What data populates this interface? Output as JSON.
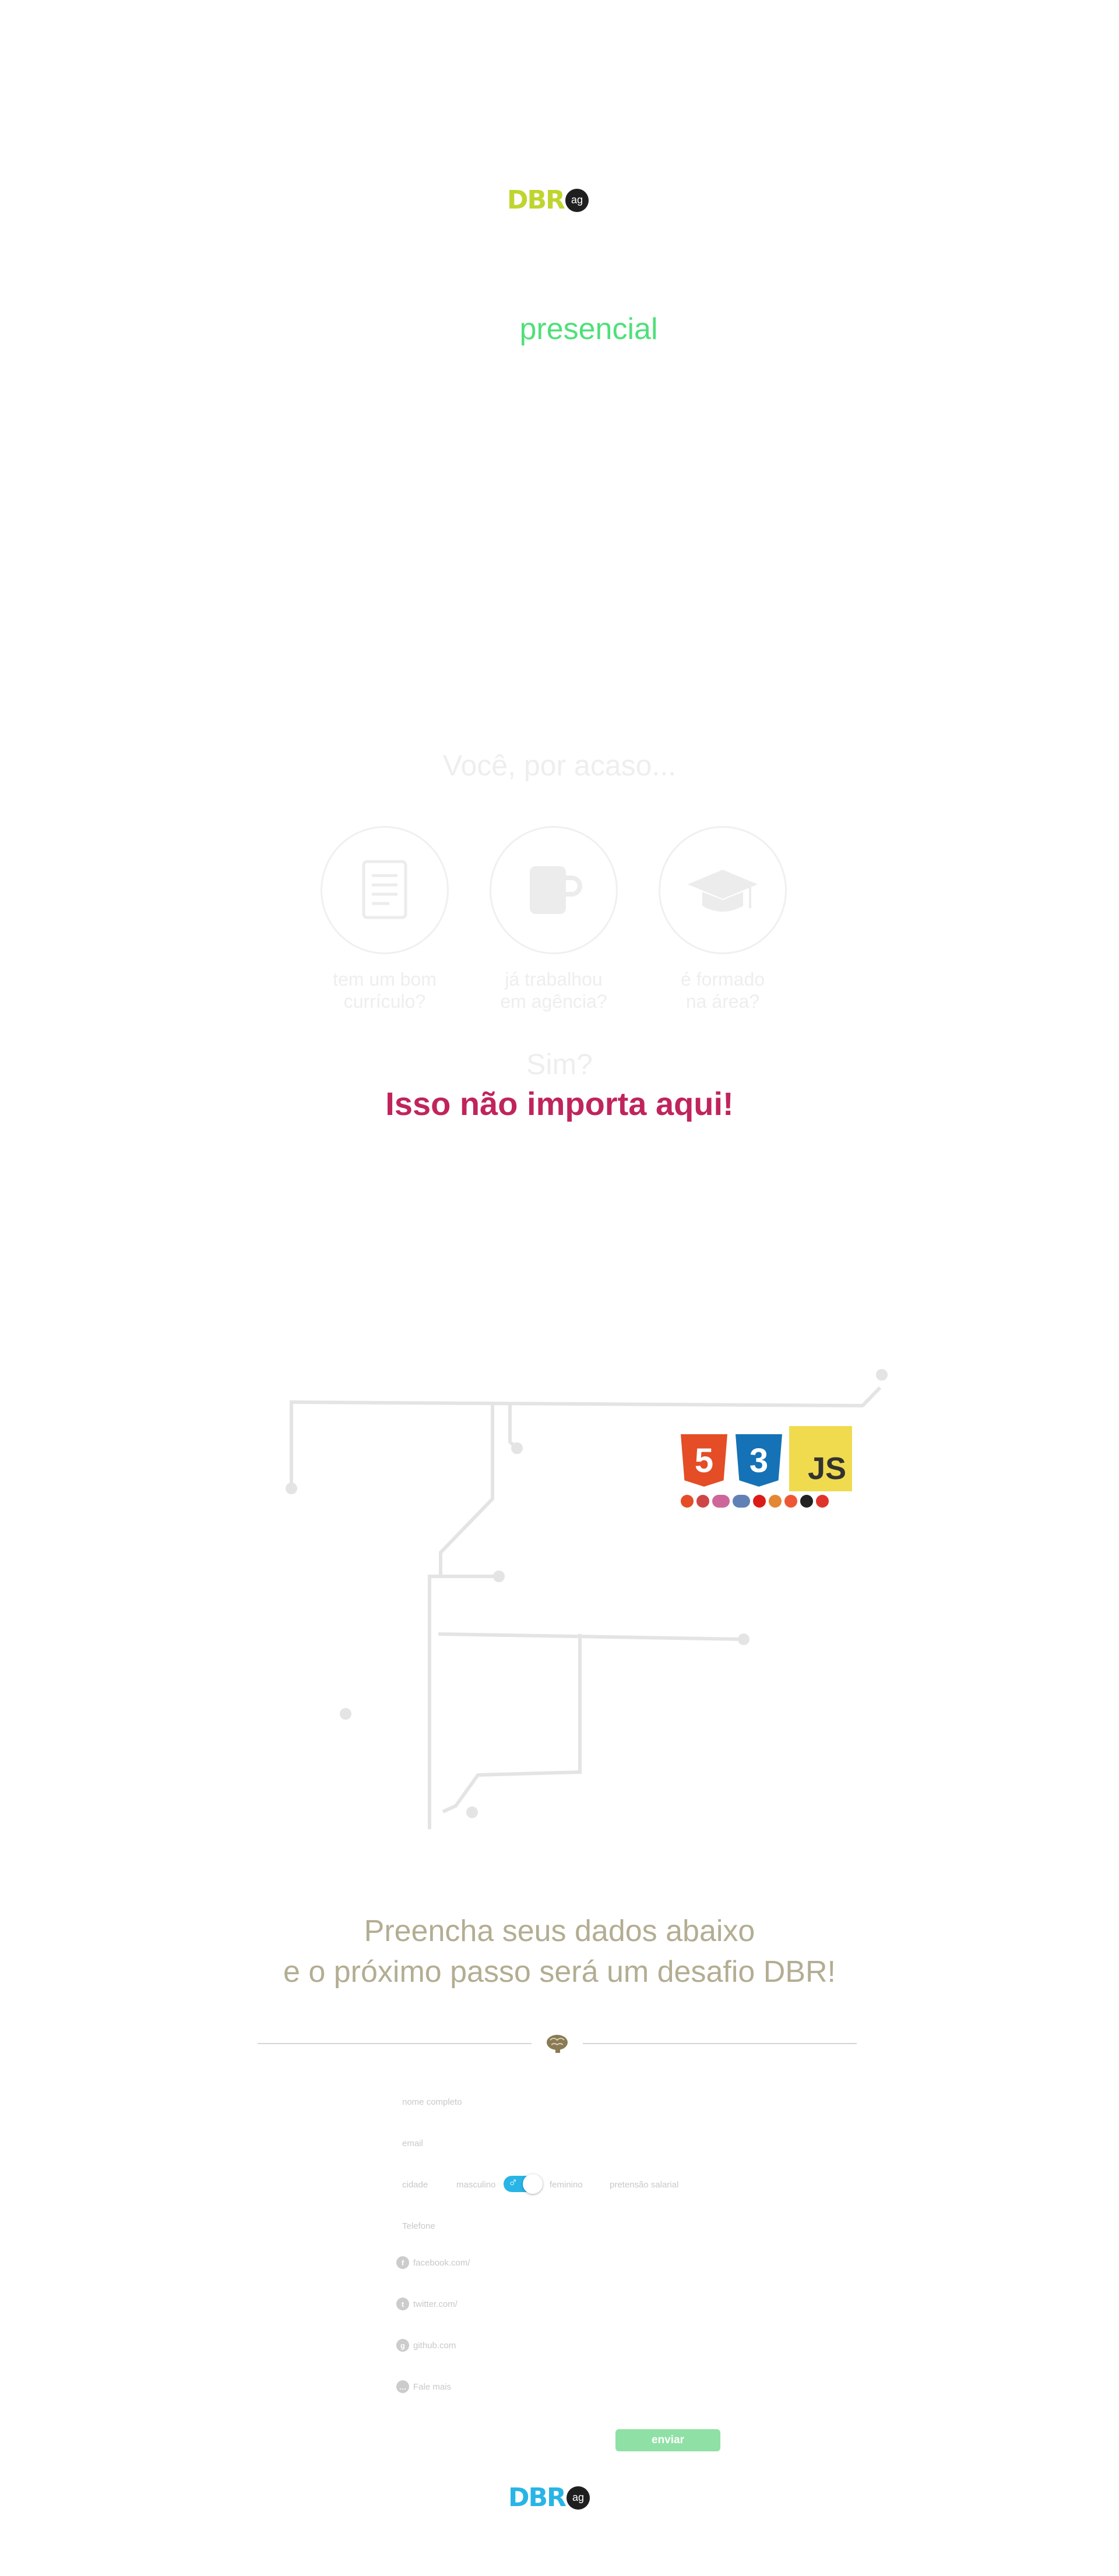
{
  "header": {
    "logo_letters": "DBR",
    "logo_badge": "ag",
    "tagline": "presencial",
    "logo_color": "#bfd52f"
  },
  "intro": {
    "title": "Você, por acaso...",
    "items": [
      {
        "icon": "document-icon",
        "label_line1": "tem um bom",
        "label_line2": "currículo?"
      },
      {
        "icon": "mug-icon",
        "label_line1": "já trabalhou",
        "label_line2": "em agência?"
      },
      {
        "icon": "graduation-cap-icon",
        "label_line1": "é formado",
        "label_line2": "na área?"
      }
    ],
    "question": "Sim?",
    "answer": "Isso não importa aqui!",
    "answer_color": "#c0245c"
  },
  "tech": {
    "html_badge": "5",
    "css_badge": "3",
    "js_badge": "JS",
    "colors": {
      "html": "#e44d26",
      "css": "#1572b6",
      "js": "#f0db4f"
    }
  },
  "form": {
    "title_line1": "Preencha seus dados abaixo",
    "title_line2": "e o próximo passo será um desafio DBR!",
    "fields": {
      "name_placeholder": "nome completo",
      "email_placeholder": "email",
      "city_placeholder": "cidade",
      "gender_male": "masculino",
      "gender_female": "feminino",
      "salary_placeholder": "pretensão salarial",
      "phone_placeholder": "Telefone",
      "facebook_placeholder": "facebook.com/",
      "twitter_placeholder": "twitter.com/",
      "github_placeholder": "github.com",
      "about_placeholder": "Fale mais"
    },
    "submit_label": "enviar",
    "gender_symbol": "♂",
    "toggle_color": "#29b4e6"
  },
  "footer": {
    "logo_letters": "DBR",
    "logo_badge": "ag",
    "logo_color": "#29b4e6"
  }
}
